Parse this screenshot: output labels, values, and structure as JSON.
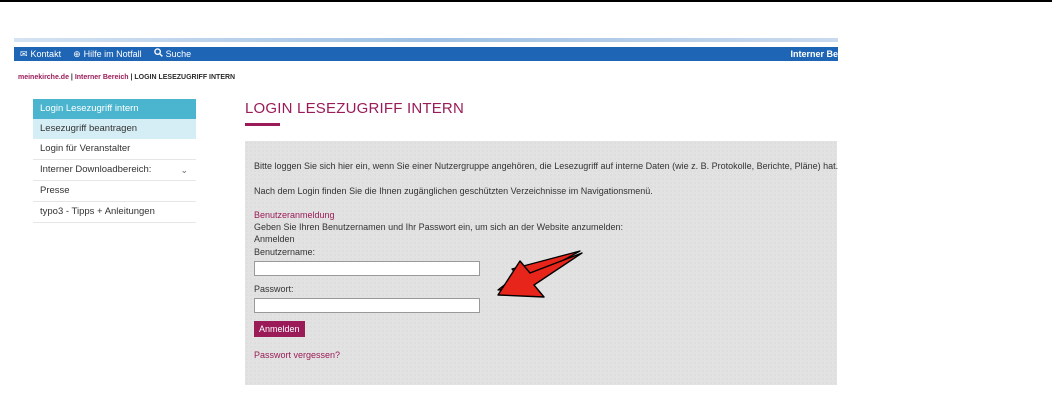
{
  "topbar": {
    "contact": "Kontakt",
    "emergency": "Hilfe im Notfall",
    "search": "Suche",
    "internal": "Interner Be"
  },
  "breadcrumb": {
    "site": "meinekirche.de",
    "section": "Interner Bereich",
    "current": "LOGIN LESEZUGRIFF INTERN",
    "sep": " | "
  },
  "sidebar": {
    "items": [
      {
        "label": "Login Lesezugriff intern"
      },
      {
        "label": "Lesezugriff beantragen"
      },
      {
        "label": "Login für Veranstalter"
      },
      {
        "label": "Interner Downloadbereich:"
      },
      {
        "label": "Presse"
      },
      {
        "label": "typo3 - Tipps + Anleitungen"
      }
    ]
  },
  "main": {
    "title": "LOGIN LESEZUGRIFF INTERN",
    "intro": "Bitte loggen Sie sich hier ein, wenn Sie einer Nutzergruppe angehören, die Lesezugriff auf interne Daten (wie z. B. Protokolle, Berichte, Pläne) hat.",
    "after_login": "Nach dem Login finden Sie die Ihnen zugänglichen geschützten Verzeichnisse im Navigationsmenü.",
    "section_heading": "Benutzeranmeldung",
    "description": "Geben Sie Ihren Benutzernamen und Ihr Passwort ein, um sich an der Website anzumelden:",
    "legend": "Anmelden",
    "username_label": "Benutzername:",
    "username_value": "",
    "password_label": "Passwort:",
    "password_value": "",
    "login_button": "Anmelden",
    "forgot_link": "Passwort vergessen?"
  },
  "colors": {
    "brand": "#9a1b58",
    "topbar": "#1f65b5",
    "active_nav": "#4bb5cf",
    "sub_nav": "#d5eef5",
    "arrow": "#e8251b"
  },
  "icons": {
    "contact": "envelope-icon",
    "emergency": "lifebuoy-icon",
    "search": "magnifier-icon",
    "submenu": "chevron-down-icon",
    "annotation": "red-arrow-icon"
  }
}
